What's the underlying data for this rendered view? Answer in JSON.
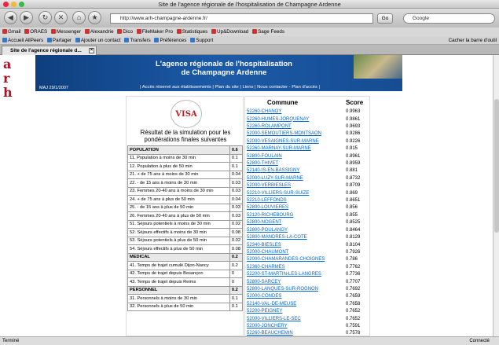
{
  "window": {
    "title": "Site de l'agence régionale de l'hospitalisation de Champagne Ardenne"
  },
  "toolbar": {
    "url": "http://www.arh-champagne-ardenne.fr/",
    "go_label": "Go",
    "search_value": "Google"
  },
  "bookmarks": [
    "Gmail",
    "ORAES",
    "Messenger",
    "Alexandrie",
    "Dico",
    "FileMaker Pro",
    "Statistiques",
    "Up&Download",
    "Sage Feeds"
  ],
  "bookmarks2": [
    "Accueil AllPeers",
    "Partager",
    "Ajouter un contact",
    "Transfers",
    "Préférences",
    "Support"
  ],
  "bookmarks2_right": "Cacher la barre d'outil",
  "tab": {
    "label": "Site de l'agence régionale d..."
  },
  "banner": {
    "title_line1": "L'agence régionale de l'hospitalisation",
    "title_line2": "de Champagne Ardenne",
    "maj": "MAJ 29/1/2007",
    "links": "| Accès réservé aux établissements | Plan du site | Liens | Nous contacter - Plan d'accès |"
  },
  "left": {
    "logo_text": "VISA",
    "title": "Résultat de la simulation pour les pondérations finales suivantes",
    "rows": [
      {
        "label": "POPULATION",
        "value": "0.6",
        "header": true
      },
      {
        "label": "11. Population à moins de 30 min",
        "value": "0.1"
      },
      {
        "label": "12. Population à plus de 50 min",
        "value": "0.1"
      },
      {
        "label": "21. + de 75 ans à moins de 30 min",
        "value": "0.04"
      },
      {
        "label": "22. - de 15 ans à moins de 30 min",
        "value": "0.03"
      },
      {
        "label": "23. Femmes 20-40 ans à moins de 30 min",
        "value": "0.03"
      },
      {
        "label": "24. + de 75 ans à plus de 50 min",
        "value": "0.04"
      },
      {
        "label": "25. - de 15 ans à plus de 50 min",
        "value": "0.03"
      },
      {
        "label": "26. Femmes 20-40 ans à plus de 50 min",
        "value": "0.03"
      },
      {
        "label": "51. Séjours potentiels à moins de 30 min",
        "value": "0.02"
      },
      {
        "label": "52. Séjours effectifs à moins de 30 min",
        "value": "0.08"
      },
      {
        "label": "53. Séjours potentiels à plus de 50 min",
        "value": "0.02"
      },
      {
        "label": "54. Séjours effectifs à plus de 50 min",
        "value": "0.08"
      },
      {
        "label": "MEDICAL",
        "value": "0.2",
        "header": true
      },
      {
        "label": "41. Temps de trajet cumulé Dijon-Nancy",
        "value": "0.2"
      },
      {
        "label": "42. Temps de trajet depuis Besançon",
        "value": "0"
      },
      {
        "label": "43. Temps de trajet depuis Reims",
        "value": "0"
      },
      {
        "label": "PERSONNEL",
        "value": "0.2",
        "header": true
      },
      {
        "label": "31. Personnels à moins de 30 min",
        "value": "0.1"
      },
      {
        "label": "32. Personnels à plus de 50 min",
        "value": "0.1"
      }
    ]
  },
  "right": {
    "col_commune": "Commune",
    "col_score": "Score",
    "rows": [
      {
        "commune": "52260-CHANOY",
        "score": "0.9963"
      },
      {
        "commune": "52260-HUMES-JORQUENAY",
        "score": "0.9861"
      },
      {
        "commune": "52260-ROLAMPONT",
        "score": "0.9693"
      },
      {
        "commune": "52000-SEMOUTIERS-MONTSAON",
        "score": "0.9286"
      },
      {
        "commune": "52000-VESAIGNES-SUR-MARNE",
        "score": "0.9226"
      },
      {
        "commune": "52260-MARNAY-SUR-MARNE",
        "score": "0.915"
      },
      {
        "commune": "52800-FOULAIN",
        "score": "0.8961"
      },
      {
        "commune": "52800-THIVET",
        "score": "0.8959"
      },
      {
        "commune": "52140-IS-EN-BASSIGNY",
        "score": "0.881"
      },
      {
        "commune": "52000-LUZY-SUR-MARNE",
        "score": "0.8732"
      },
      {
        "commune": "52000-VERBIESLES",
        "score": "0.8709"
      },
      {
        "commune": "52210-VILLIERS-SUR-SUIZE",
        "score": "0.869"
      },
      {
        "commune": "52210-LEFFONDS",
        "score": "0.8651"
      },
      {
        "commune": "52800-LOUVIERES",
        "score": "0.856"
      },
      {
        "commune": "52120-RICHEBOURG",
        "score": "0.855"
      },
      {
        "commune": "52800-NOGENT",
        "score": "0.8525"
      },
      {
        "commune": "52800-POULANGY",
        "score": "0.8464"
      },
      {
        "commune": "52800-MANDRES-LA-COTE",
        "score": "0.8129"
      },
      {
        "commune": "52340-BIESLES",
        "score": "0.8104"
      },
      {
        "commune": "52000-CHAUMONT",
        "score": "0.7926"
      },
      {
        "commune": "52000-CHAMARANDES-CHOIGNES",
        "score": "0.786"
      },
      {
        "commune": "52360-CHARMES",
        "score": "0.7762"
      },
      {
        "commune": "52200-ST-MARTIN-LES-LANGRES",
        "score": "0.7736"
      },
      {
        "commune": "52800-SARCEY",
        "score": "0.7707"
      },
      {
        "commune": "52800-LANQUES-SUR-ROGNON",
        "score": "0.7692"
      },
      {
        "commune": "52000-CONDES",
        "score": "0.7659"
      },
      {
        "commune": "52140-VAL-DE-MEUSE",
        "score": "0.7658"
      },
      {
        "commune": "52200-PEIGNEY",
        "score": "0.7652"
      },
      {
        "commune": "52000-VILLIERS-LE-SEC",
        "score": "0.7652"
      },
      {
        "commune": "52000-JONCHERY",
        "score": "0.7591"
      },
      {
        "commune": "52260-BEAUCHEMIN",
        "score": "0.7578"
      }
    ]
  },
  "status": {
    "left": "Terminé",
    "right": "Connecté"
  }
}
